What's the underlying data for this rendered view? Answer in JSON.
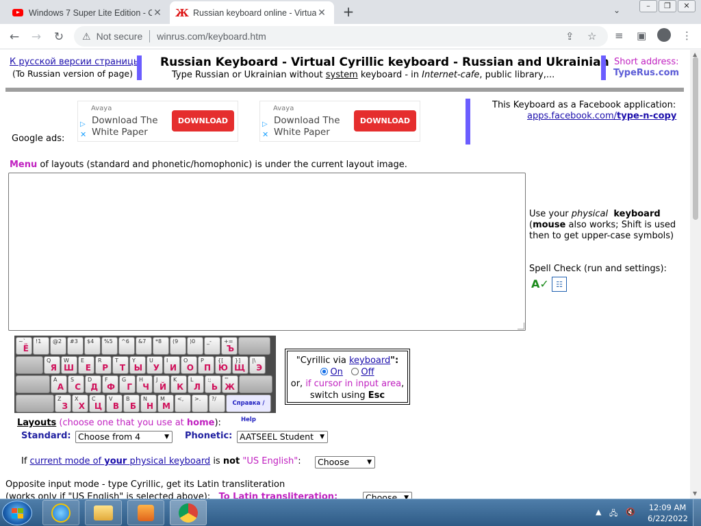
{
  "browser": {
    "tabs": [
      {
        "title": "Windows 7 Super Lite Edition - O",
        "icon": "youtube-icon",
        "active": false
      },
      {
        "title": "Russian keyboard online - Virtual",
        "icon": "zh-letter-icon",
        "active": true
      }
    ],
    "address": {
      "security": "Not secure",
      "url": "winrus.com/keyboard.htm"
    }
  },
  "header": {
    "russian_link": "К русской версии страницы",
    "russian_sub": "(To Russian version of page)",
    "title": "Russian Keyboard - Virtual Cyrillic keyboard - Russian and Ukrainian",
    "subtitle_1": "Type Russian or Ukrainian without ",
    "subtitle_system": "system",
    "subtitle_2": " keyboard - in ",
    "subtitle_cafe": "Internet-cafe",
    "subtitle_3": ", public library,...",
    "short_label": "Short address:",
    "short_value": "TypeRus.com"
  },
  "ads": {
    "label": "Google ads:",
    "items": [
      {
        "brand": "Avaya",
        "text": "Download The White Paper",
        "button": "DOWNLOAD"
      },
      {
        "brand": "Avaya",
        "text": "Download The White Paper",
        "button": "DOWNLOAD"
      }
    ]
  },
  "facebook": {
    "label": "This Keyboard as a Facebook application:",
    "link_prefix": "apps.facebook.com/",
    "link_bold": "type-n-copy"
  },
  "menu_line": {
    "menu": "Menu",
    "rest": " of layouts (standard and phonetic/homophonic) is under the current layout image."
  },
  "side": {
    "use_1": "Use your ",
    "use_physical": "physical",
    "use_keyboard": "keyboard",
    "use_mouse": "mouse",
    "use_2": " also works; Shift is used then to get upper-case symbols)",
    "spell": "Spell Check (run and settings):"
  },
  "keyboard": {
    "rows": [
      [
        {
          "l": "~`",
          "c": "Ё"
        },
        {
          "l": "!1",
          "c": ""
        },
        {
          "l": "@2",
          "c": ""
        },
        {
          "l": "#3",
          "c": ""
        },
        {
          "l": "$4",
          "c": ""
        },
        {
          "l": "%5",
          "c": ""
        },
        {
          "l": "^6",
          "c": ""
        },
        {
          "l": "&7",
          "c": ""
        },
        {
          "l": "*8",
          "c": ""
        },
        {
          "l": "(9",
          "c": ""
        },
        {
          "l": ")0",
          "c": ""
        },
        {
          "l": "_-",
          "c": ""
        },
        {
          "l": "+=",
          "c": "Ъ"
        }
      ],
      [
        {
          "l": "Q",
          "c": "Я"
        },
        {
          "l": "W",
          "c": "Ш"
        },
        {
          "l": "E",
          "c": "Е"
        },
        {
          "l": "R",
          "c": "Р"
        },
        {
          "l": "T",
          "c": "Т"
        },
        {
          "l": "Y",
          "c": "Ы"
        },
        {
          "l": "U",
          "c": "У"
        },
        {
          "l": "I",
          "c": "И"
        },
        {
          "l": "O",
          "c": "О"
        },
        {
          "l": "P",
          "c": "П"
        },
        {
          "l": "{[",
          "c": "Ю"
        },
        {
          "l": "}]",
          "c": "Щ"
        },
        {
          "l": "|\\",
          "c": "Э"
        }
      ],
      [
        {
          "l": "A",
          "c": "А"
        },
        {
          "l": "S",
          "c": "С"
        },
        {
          "l": "D",
          "c": "Д"
        },
        {
          "l": "F",
          "c": "Ф"
        },
        {
          "l": "G",
          "c": "Г"
        },
        {
          "l": "H",
          "c": "Ч"
        },
        {
          "l": "J",
          "c": "Й"
        },
        {
          "l": "K",
          "c": "К"
        },
        {
          "l": "L",
          "c": "Л"
        },
        {
          "l": ":;",
          "c": "Ь"
        },
        {
          "l": "\"'",
          "c": "Ж"
        }
      ],
      [
        {
          "l": "Z",
          "c": "З"
        },
        {
          "l": "X",
          "c": "Х"
        },
        {
          "l": "C",
          "c": "Ц"
        },
        {
          "l": "V",
          "c": "В"
        },
        {
          "l": "B",
          "c": "Б"
        },
        {
          "l": "N",
          "c": "Н"
        },
        {
          "l": "M",
          "c": "М"
        },
        {
          "l": "<,",
          "c": ""
        },
        {
          "l": ">.",
          "c": ""
        },
        {
          "l": "?/",
          "c": ""
        }
      ]
    ],
    "help": "Справка / Help"
  },
  "cyrillic_via": {
    "line1a": "\"Cyrillic via ",
    "line1b": "keyboard",
    "line1c": "\":",
    "on": "On",
    "off": "Off",
    "line3a": "or, ",
    "line3b": "if cursor in input area",
    "line3c": ",",
    "line4a": "switch using ",
    "line4b": "Esc"
  },
  "layouts": {
    "label": "Layouts",
    "hint_1": " (choose one that you use at ",
    "hint_home": "home",
    "hint_2": "):",
    "standard_label": "Standard:",
    "standard_value": "Choose from 4",
    "phonetic_label": "Phonetic:",
    "phonetic_value": "AATSEEL Student"
  },
  "mode": {
    "if": "If ",
    "link_1": "current mode of ",
    "link_your": "your",
    "link_2": " physical keyboard",
    "is": " is ",
    "not": "not",
    "us": " \"US English\"",
    "colon": ": ",
    "select": "Choose"
  },
  "opposite": {
    "line1": "Opposite input mode - type Cyrillic, get its Latin transliteration",
    "line2": "(works only if \"US English\" is selected above):",
    "to_latin": "To Latin transliteration:",
    "select": "Choose"
  },
  "taskbar": {
    "time": "12:09 AM",
    "date": "6/22/2022"
  }
}
